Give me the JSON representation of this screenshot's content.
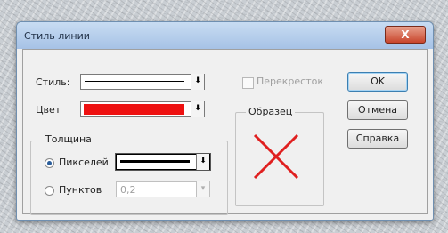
{
  "window": {
    "title": "Стиль линии",
    "close_glyph": "X"
  },
  "style_row": {
    "label": "Стиль:"
  },
  "color_row": {
    "label": "Цвет",
    "color": "#ee1111"
  },
  "intersections": {
    "label": "Перекресток",
    "checked": false,
    "enabled": false
  },
  "sample": {
    "label": "Образец",
    "color": "#e02020"
  },
  "thickness": {
    "label": "Толщина",
    "pixels_label": "Пикселей",
    "points_label": "Пунктов",
    "points_value": "0,2",
    "selected": "pixels"
  },
  "buttons": {
    "ok": "OK",
    "cancel": "Отмена",
    "help": "Справка"
  },
  "icons": {
    "dropdown": "dropdown-arrow-icon"
  }
}
